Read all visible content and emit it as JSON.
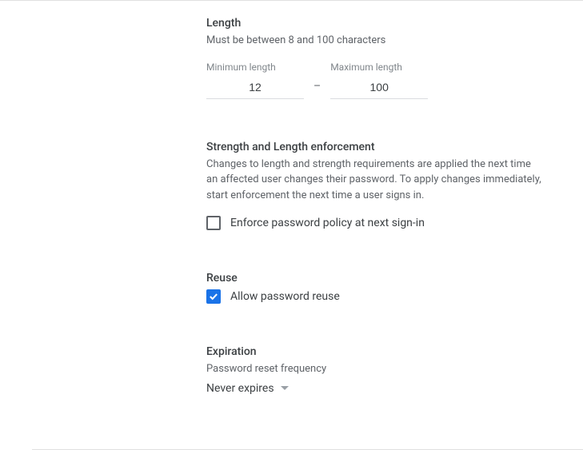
{
  "length": {
    "title": "Length",
    "desc": "Must be between 8 and 100 characters",
    "min_label": "Minimum length",
    "min_value": "12",
    "max_label": "Maximum length",
    "max_value": "100"
  },
  "enforcement": {
    "title": "Strength and Length enforcement",
    "desc": "Changes to length and strength requirements are applied the next time an affected user changes their password. To apply changes immediately, start enforcement the next time a user signs in.",
    "checkbox_label": "Enforce password policy at next sign-in"
  },
  "reuse": {
    "title": "Reuse",
    "checkbox_label": "Allow password reuse"
  },
  "expiration": {
    "title": "Expiration",
    "desc": "Password reset frequency",
    "selected": "Never expires"
  }
}
